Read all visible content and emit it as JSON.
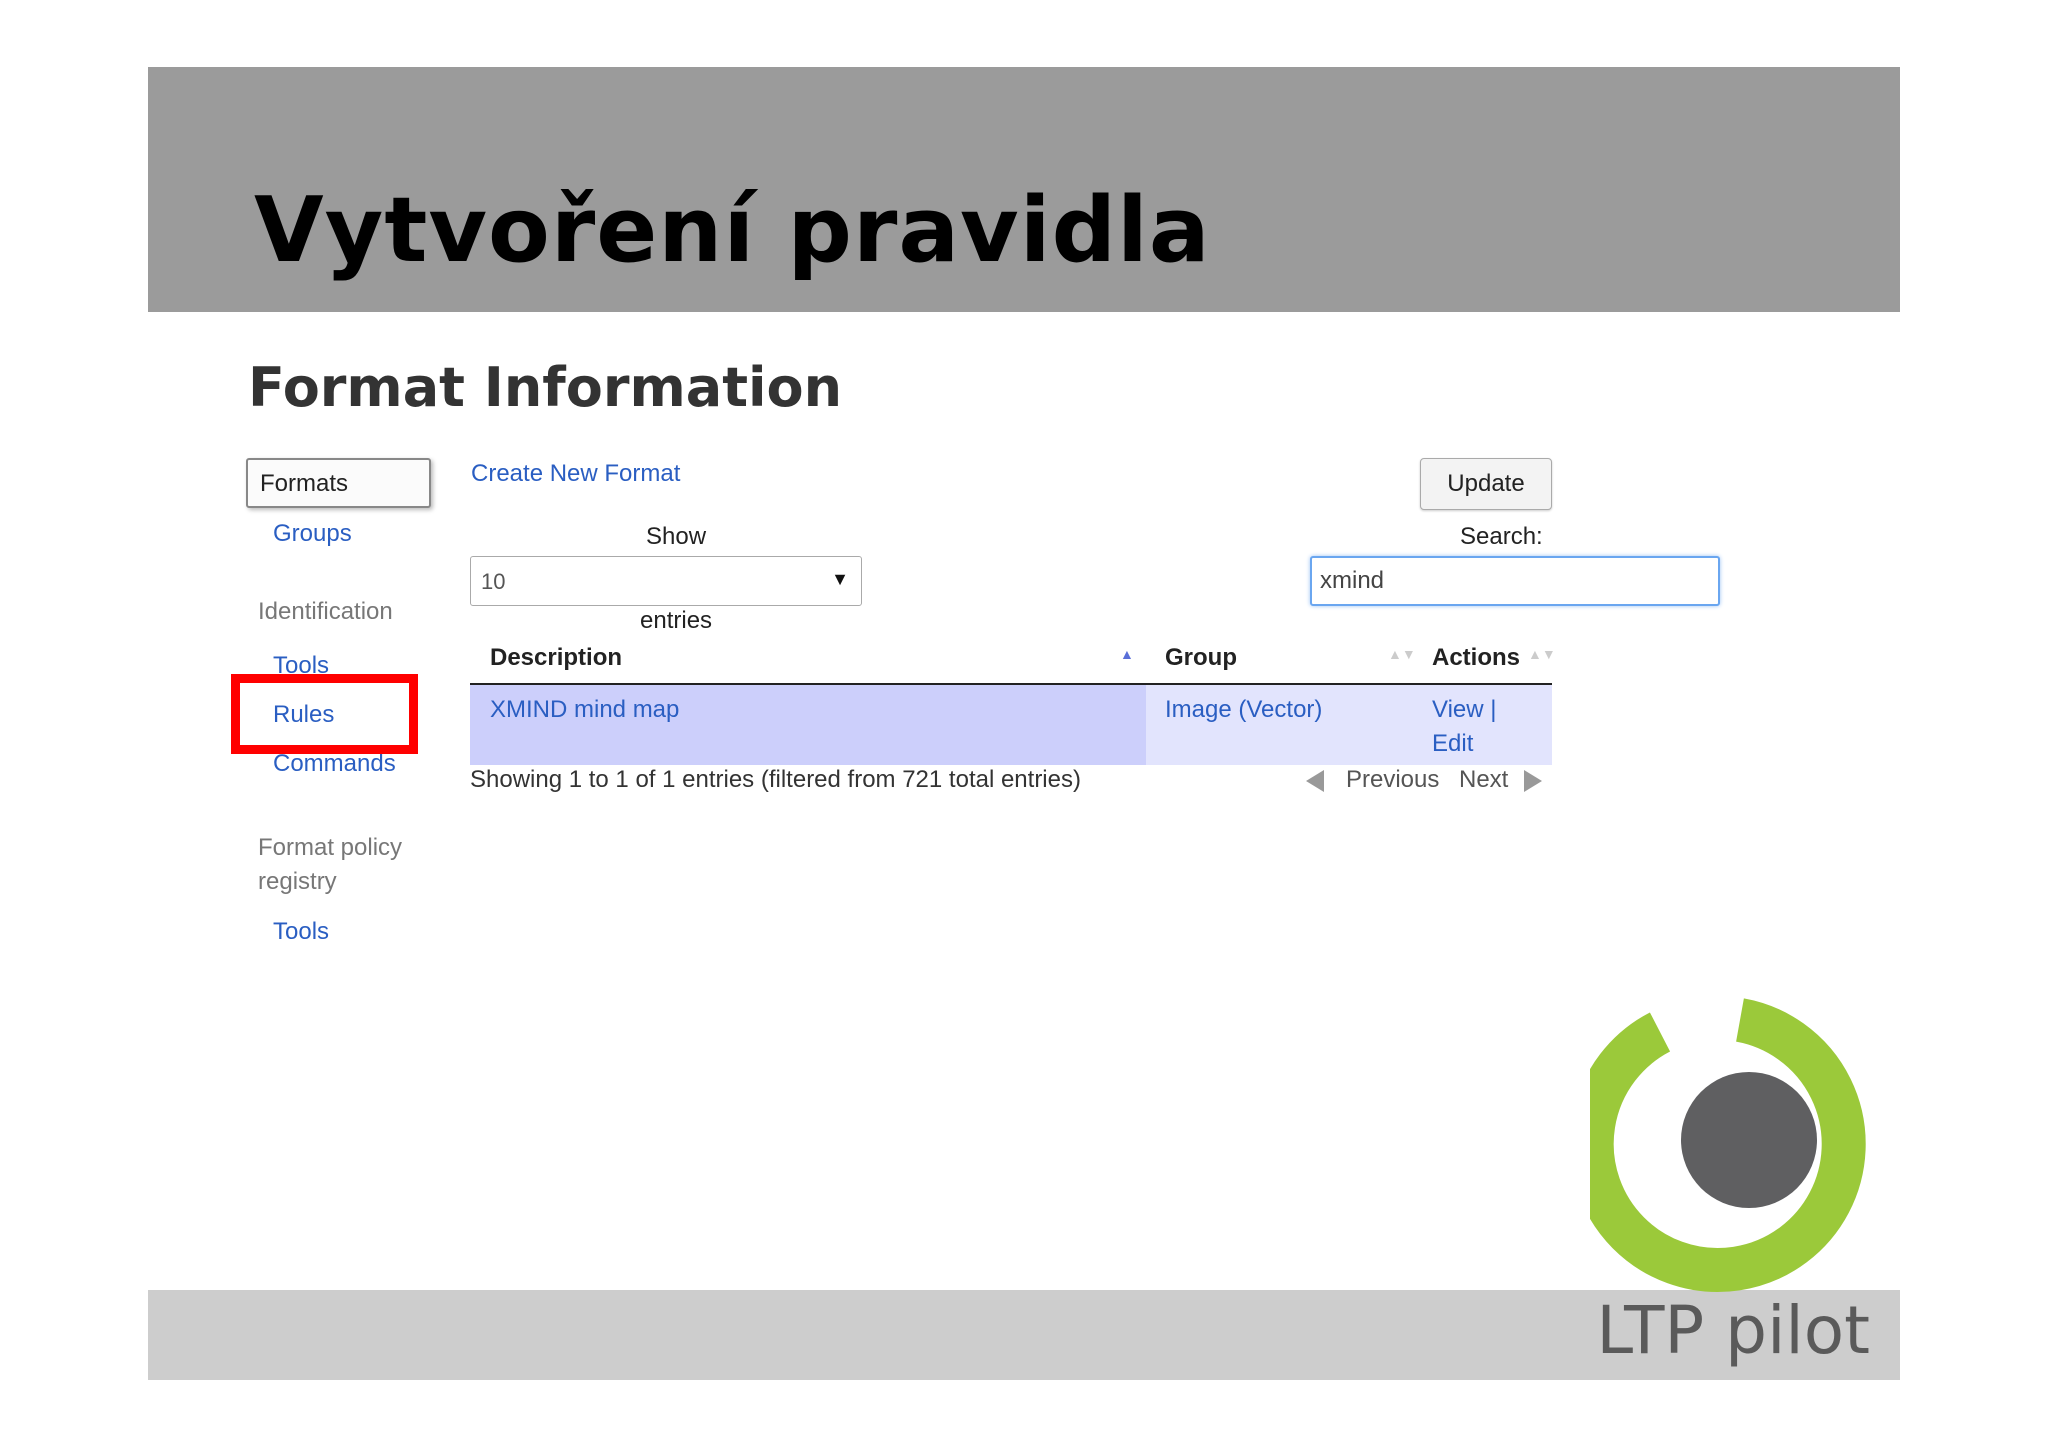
{
  "slide": {
    "title": "Vytvoření pravidla",
    "footer": "LTP pilot"
  },
  "page": {
    "heading": "Format Information"
  },
  "sidebar": {
    "formats_button": "Formats",
    "groups_link": "Groups",
    "identification_heading": "Identification",
    "tools_link": "Tools",
    "rules_link": "Rules",
    "commands_link": "Commands",
    "policy_heading_line1": "Format policy",
    "policy_heading_line2": "registry",
    "policy_tools_link": "Tools"
  },
  "toolbar": {
    "create_link": "Create New Format",
    "update_button": "Update",
    "show_label": "Show",
    "entries_label": "entries",
    "page_size": "10",
    "search_label": "Search:",
    "search_value": "xmind"
  },
  "table": {
    "columns": [
      "Description",
      "Group",
      "Actions"
    ],
    "rows": [
      {
        "description": "XMIND mind map",
        "group": "Image (Vector)",
        "view": "View |",
        "edit": "Edit"
      }
    ],
    "info": "Showing 1 to 1 of 1 entries (filtered from 721 total entries)",
    "previous": "Previous",
    "next": "Next"
  },
  "colors": {
    "link": "#2a5ec2",
    "highlight": "#ff0000",
    "logo_green": "#9bc93a",
    "logo_gray": "#5f5f61"
  }
}
